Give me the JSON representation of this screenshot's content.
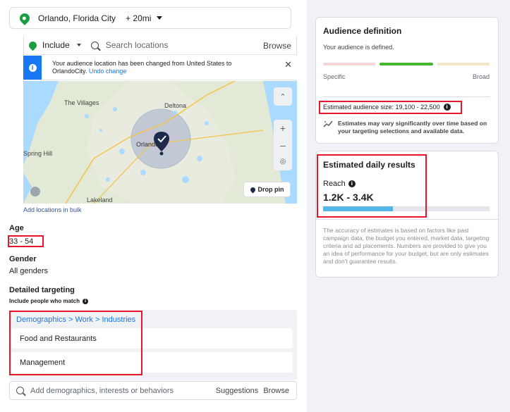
{
  "location": {
    "name": "Orlando, Florida City",
    "radius": "+ 20mi"
  },
  "include": {
    "label": "Include",
    "search_placeholder": "Search locations",
    "browse_label": "Browse"
  },
  "notice": {
    "text": "Your audience location has been changed from United States to OrlandoCity.",
    "link": "Undo change",
    "close_icon": "close-icon"
  },
  "map": {
    "labels": [
      "The Villages",
      "Deltona",
      "Orlando",
      "Spring Hill",
      "Lakeland"
    ],
    "drop_pin_label": "Drop pin"
  },
  "add_bulk": "Add locations in bulk",
  "age": {
    "heading": "Age",
    "value": "33 - 54"
  },
  "gender": {
    "heading": "Gender",
    "value": "All genders"
  },
  "detailed": {
    "heading": "Detailed targeting",
    "sub": "Include people who match",
    "breadcrumb": [
      "Demographics",
      "Work",
      "Industries"
    ],
    "items": [
      "Food and Restaurants",
      "Management"
    ],
    "search_placeholder": "Add demographics, interests or behaviors",
    "suggestions_label": "Suggestions",
    "browse_label": "Browse"
  },
  "audience": {
    "title": "Audience definition",
    "status": "Your audience is defined.",
    "specific_label": "Specific",
    "broad_label": "Broad",
    "size_text": "Estimated audience size: 19,100 - 22,500",
    "vary_text": "Estimates may vary significantly over time based on your targeting selections and available data."
  },
  "daily": {
    "title": "Estimated daily results",
    "reach_label": "Reach",
    "reach_value": "1.2K - 3.4K",
    "reach_fill": 0.42,
    "disclaimer": "The accuracy of estimates is based on factors like past campaign data, the budget you entered, market data, targeting criteria and ad placements. Numbers are provided to give you an idea of performance for your budget, but are only estimates and don't guarantee results."
  },
  "colors": {
    "accent": "#1877f2",
    "green": "#42b72a",
    "highlight_red": "#e8162a",
    "reach_bar": "#55b5e6"
  }
}
